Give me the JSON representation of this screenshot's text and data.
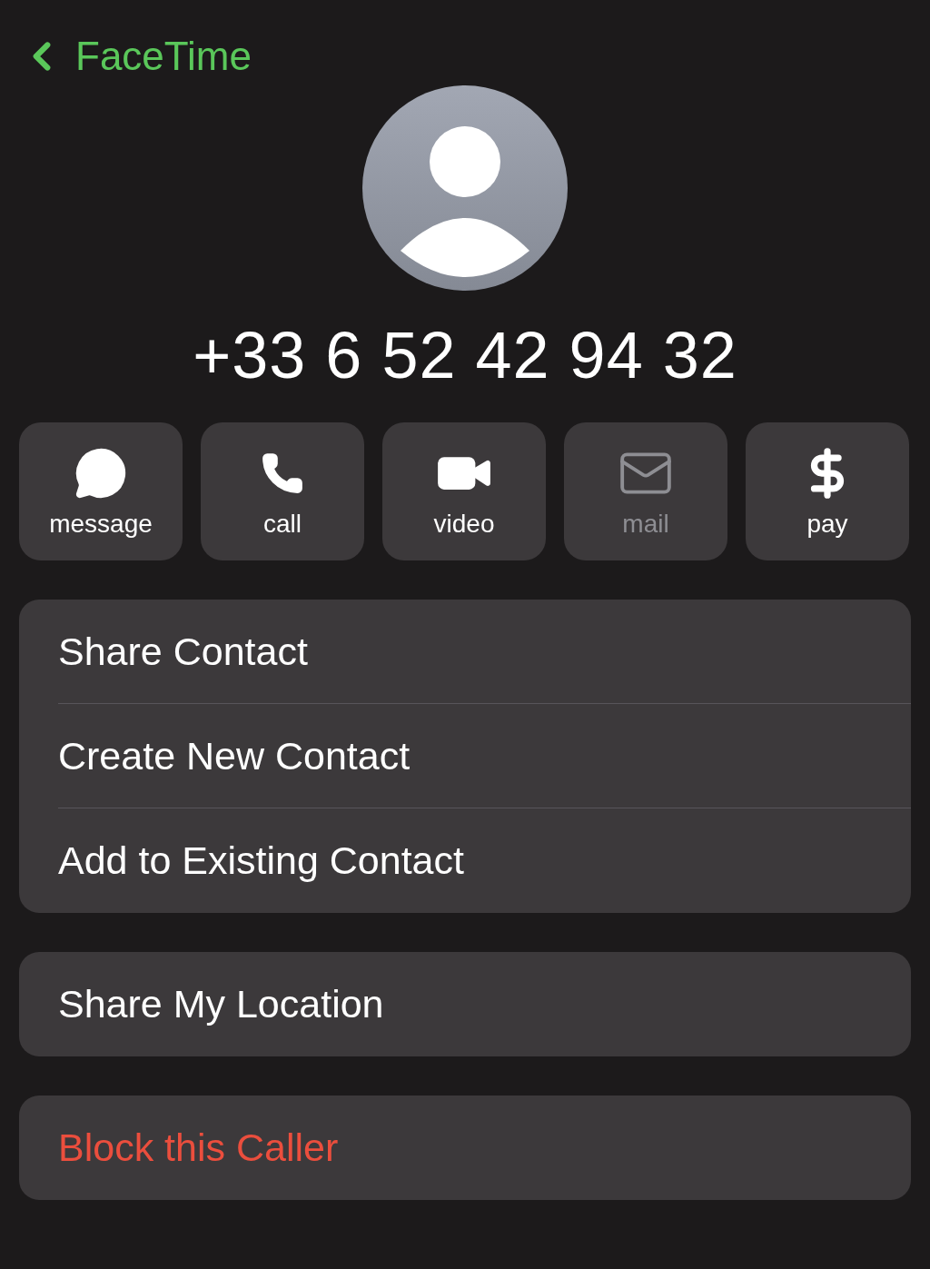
{
  "nav": {
    "back_label": "FaceTime"
  },
  "contact": {
    "phone": "+33 6 52 42 94 32"
  },
  "actions": [
    {
      "kind": "message",
      "label": "message",
      "disabled": false
    },
    {
      "kind": "call",
      "label": "call",
      "disabled": false
    },
    {
      "kind": "video",
      "label": "video",
      "disabled": false
    },
    {
      "kind": "mail",
      "label": "mail",
      "disabled": true
    },
    {
      "kind": "pay",
      "label": "pay",
      "disabled": false
    }
  ],
  "groups": [
    {
      "items": [
        {
          "label": "Share Contact",
          "kind": "normal"
        },
        {
          "label": "Create New Contact",
          "kind": "normal"
        },
        {
          "label": "Add to Existing Contact",
          "kind": "normal"
        }
      ]
    },
    {
      "items": [
        {
          "label": "Share My Location",
          "kind": "normal"
        }
      ]
    },
    {
      "items": [
        {
          "label": "Block this Caller",
          "kind": "destructive"
        }
      ]
    }
  ]
}
